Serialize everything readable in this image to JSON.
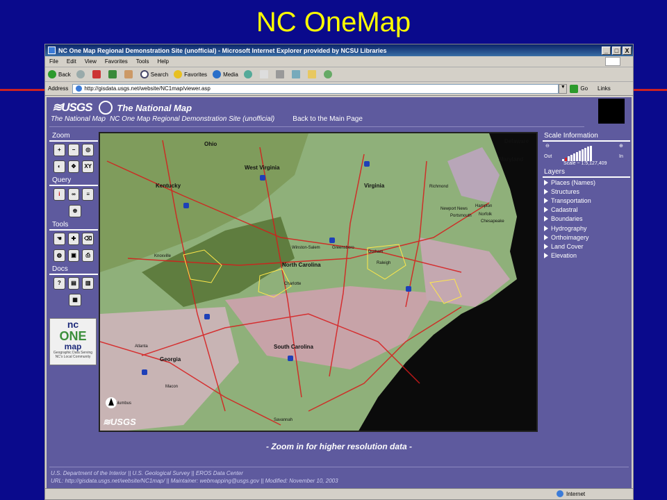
{
  "slide": {
    "title": "NC OneMap"
  },
  "window": {
    "title": "NC One Map Regional Demonstration Site (unofficial) - Microsoft Internet Explorer provided by NCSU Libraries",
    "buttons": {
      "minimize": "_",
      "maximize": "□",
      "close": "X"
    }
  },
  "menu": [
    "File",
    "Edit",
    "View",
    "Favorites",
    "Tools",
    "Help"
  ],
  "toolbar": {
    "back": "Back",
    "search": "Search",
    "favorites": "Favorites",
    "media": "Media"
  },
  "address": {
    "label": "Address",
    "url": "http://gisdata.usgs.net/website/NC1map/viewer.asp",
    "go": "Go",
    "links": "Links"
  },
  "header": {
    "usgs": "≋USGS",
    "national_map": "The National Map",
    "nav": [
      "The National Map",
      "NC One Map Regional Demonstration Site (unofficial)",
      "Back to the Main Page"
    ]
  },
  "left_panel": {
    "sections": [
      "Zoom",
      "Query",
      "Tools",
      "Docs"
    ],
    "xy_label": "XY"
  },
  "nc_logo": {
    "nc": "nc",
    "one": "ONE",
    "map": "map",
    "tagline": "Geographic Data Serving NC's Local Community"
  },
  "map": {
    "labels": {
      "ohio": "Ohio",
      "west_virginia": "West Virginia",
      "kentucky": "Kentucky",
      "virginia": "Virginia",
      "north_carolina": "North Carolina",
      "south_carolina": "South Carolina",
      "georgia": "Georgia",
      "delaware": "Delaware",
      "maryland": "Maryland",
      "richmond": "Richmond",
      "newport_news": "Newport News",
      "hampton": "Hampton",
      "norfolk": "Norfolk",
      "portsmouth": "Portsmouth",
      "chesapeake": "Chesapeake",
      "winston_salem": "Winston-Salem",
      "greensboro": "Greensboro",
      "durham": "Durham",
      "raleigh": "Raleigh",
      "knoxville": "Knoxville",
      "charlotte": "Charlotte",
      "atlanta": "Atlanta",
      "macon": "Macon",
      "columbus": "Columbus",
      "savannah": "Savannah"
    },
    "usgs_mark": "≋USGS"
  },
  "right_panel": {
    "scale_header": "Scale Information",
    "out": "Out",
    "in": "In",
    "scale_text": "Scale ~ 1:5,127,409",
    "layers_header": "Layers",
    "layers": [
      "Places (Names)",
      "Structures",
      "Transportation",
      "Cadastral",
      "Boundaries",
      "Hydrography",
      "Orthoimagery",
      "Land Cover",
      "Elevation"
    ]
  },
  "zoom_message": "- Zoom in for higher resolution data -",
  "footer": {
    "line1": "U.S. Department of the Interior   ||   U.S. Geological Survey   ||   EROS Data Center",
    "line2": "URL: http://gisdata.usgs.net/website/NC1map/   ||   Maintainer: webmapping@usgs.gov   ||   Modified: November 10, 2003"
  },
  "status": {
    "zone": "Internet"
  }
}
